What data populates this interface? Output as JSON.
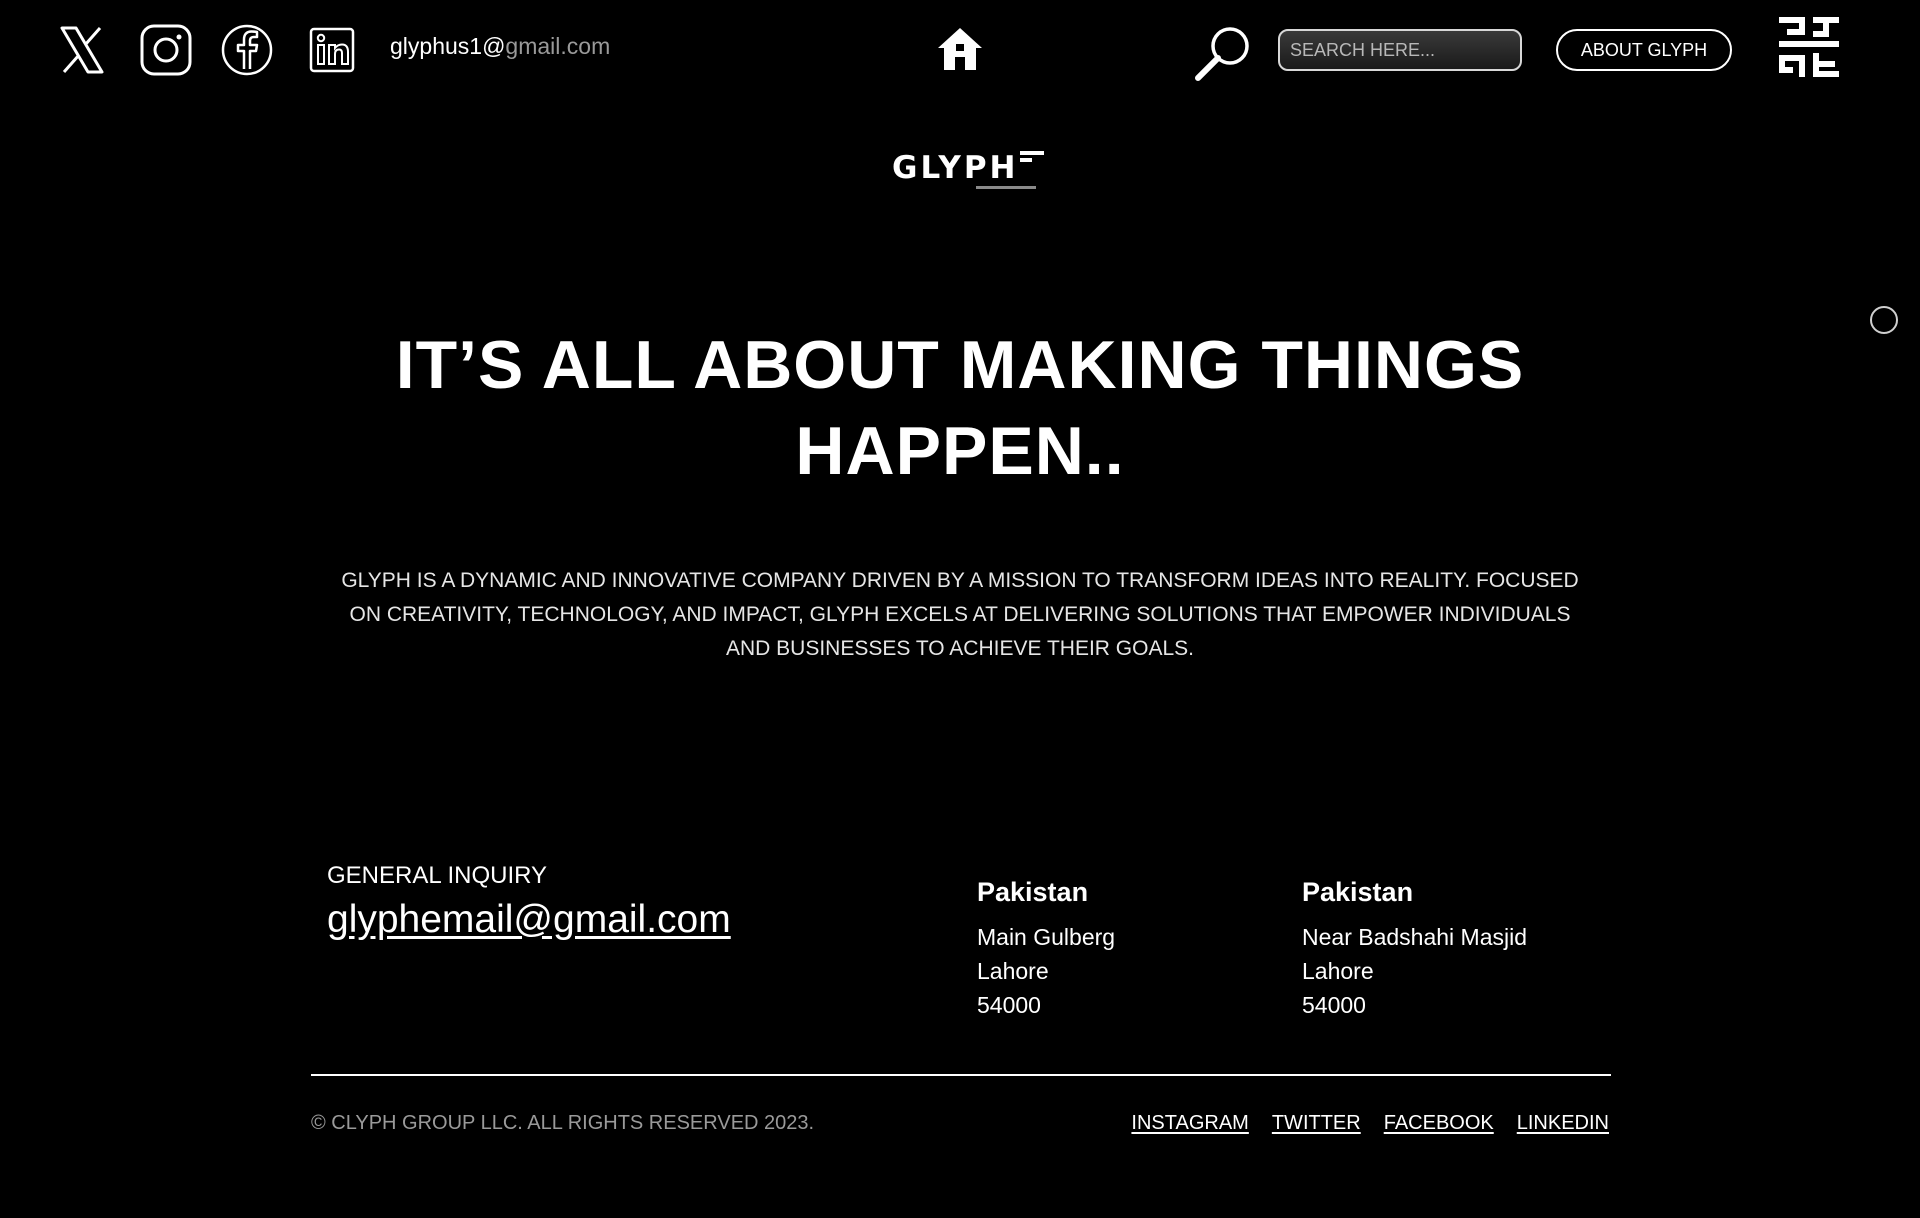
{
  "header": {
    "social_icons": [
      "x-icon",
      "instagram-icon",
      "facebook-icon",
      "linkedin-icon"
    ],
    "email_user": "glyphus1@",
    "email_domain": "gmail.com",
    "home_icon": "home-icon",
    "search_icon": "search-icon",
    "search_placeholder": "SEARCH HERE...",
    "about_label": "ABOUT GLYPH",
    "brand_mark_icon": "glyph-brand-icon"
  },
  "logo": {
    "text": "GLYPH"
  },
  "hero": {
    "title": "IT’S ALL ABOUT MAKING THINGS HAPPEN..",
    "description": "GLYPH IS A DYNAMIC AND INNOVATIVE COMPANY DRIVEN BY A MISSION TO TRANSFORM IDEAS INTO REALITY. FOCUSED ON CREATIVITY, TECHNOLOGY, AND IMPACT, GLYPH EXCELS AT DELIVERING SOLUTIONS THAT EMPOWER INDIVIDUALS AND BUSINESSES TO ACHIEVE THEIR GOALS."
  },
  "contact": {
    "inquiry_label": "GENERAL INQUIRY",
    "inquiry_email": "glyphemail@gmail.com",
    "offices": [
      {
        "country": "Pakistan",
        "lines": [
          "Main Gulberg",
          "Lahore",
          "54000"
        ]
      },
      {
        "country": "Pakistan",
        "lines": [
          "Near Badshahi Masjid",
          "Lahore",
          "54000"
        ]
      }
    ]
  },
  "footer": {
    "copyright": "© CLYPH GROUP LLC. ALL RIGHTS RESERVED 2023.",
    "links": [
      "INSTAGRAM",
      "TWITTER",
      "FACEBOOK",
      "LINKEDIN"
    ]
  },
  "colors": {
    "background": "#000000",
    "text": "#ffffff",
    "muted": "#9a9a9a"
  }
}
